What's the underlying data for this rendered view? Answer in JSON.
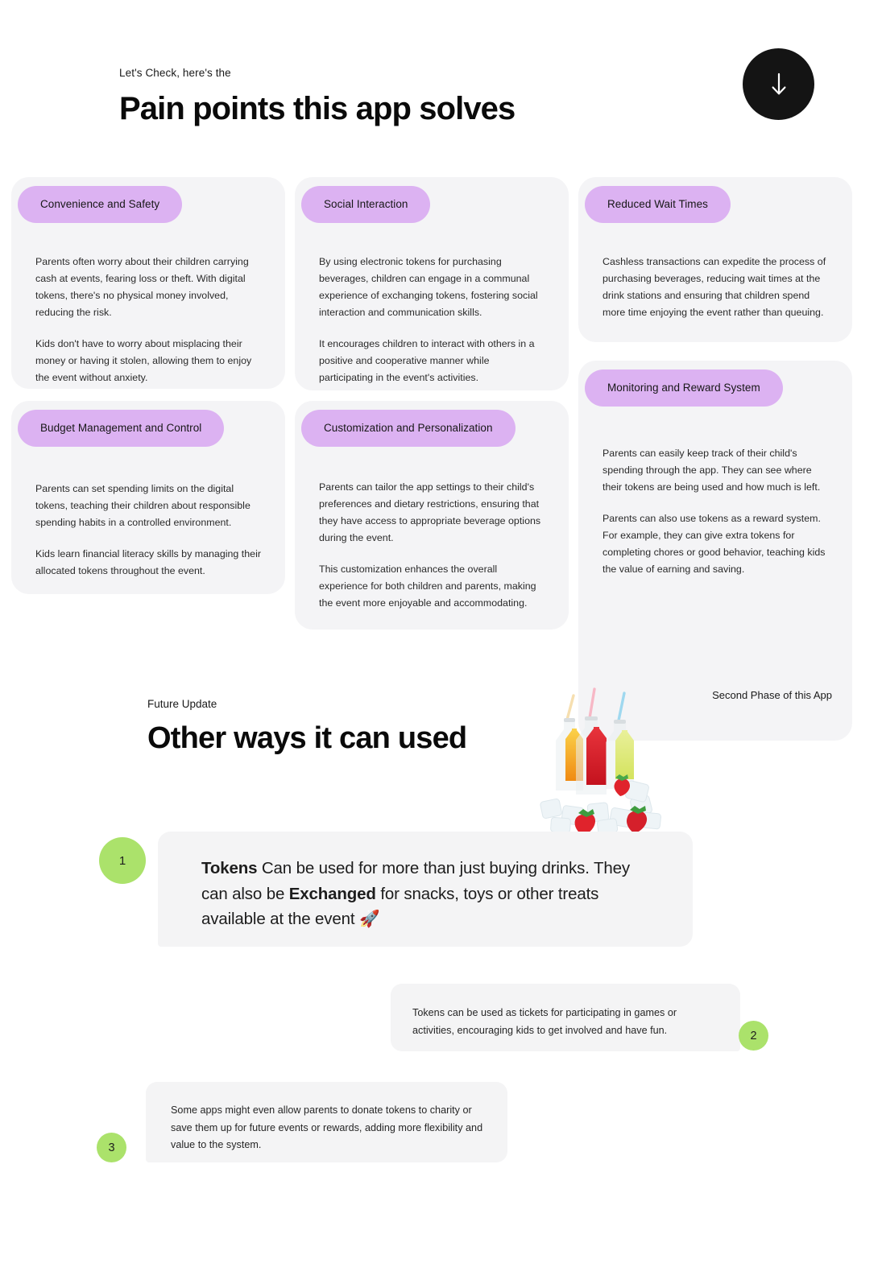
{
  "section1": {
    "eyebrow": "Let's Check, here's the",
    "title": "Pain points this app solves",
    "scroll_button_icon": "arrow-down-icon",
    "accent_pill_color": "#DCB2F2",
    "card_bg_color": "#F4F4F6",
    "cards": [
      {
        "pill": "Convenience and Safety",
        "paragraphs": [
          "Parents often worry about their children carrying cash at events, fearing loss or theft. With digital tokens, there's no physical money involved, reducing the risk.",
          "Kids don't have to worry about misplacing their money or having it stolen, allowing them to enjoy the event without anxiety."
        ]
      },
      {
        "pill": "Social Interaction",
        "paragraphs": [
          "By using electronic tokens for purchasing beverages, children can engage in a communal experience of exchanging tokens, fostering social interaction and communication skills.",
          "It encourages children to interact with others in a positive and cooperative manner while participating in the event's activities."
        ]
      },
      {
        "pill": "Reduced Wait Times",
        "paragraphs": [
          "Cashless transactions can expedite the process of purchasing beverages, reducing wait times at the drink stations and ensuring that children spend more time enjoying the event rather than queuing."
        ]
      },
      {
        "pill": "Monitoring and Reward System",
        "paragraphs": [
          "Parents can easily keep track of their child's spending through the app. They can see where their tokens are being used and how much is left.",
          "Parents can also use tokens as a reward system. For example, they can give extra tokens for completing chores or good behavior, teaching kids the value of earning and saving."
        ]
      },
      {
        "pill": "Budget Management and Control",
        "paragraphs": [
          "Parents can set spending limits on the digital tokens, teaching their children about responsible spending habits in a controlled environment.",
          "Kids learn financial literacy skills by managing their allocated tokens throughout the event."
        ]
      },
      {
        "pill": "Customization and Personalization",
        "paragraphs": [
          "Parents can tailor the app settings to their child's preferences and dietary restrictions, ensuring that they have access to appropriate beverage options during the event.",
          "This customization enhances the overall experience for both children and parents, making the event more enjoyable and accommodating."
        ]
      }
    ]
  },
  "section2": {
    "eyebrow": "Future Update",
    "title": "Other ways it can used",
    "phase_label": "Second Phase of this App",
    "illustration": "drink-bottles-on-ice-image",
    "badge_color": "#ABE26B",
    "bubble_bg_color": "#F4F4F5",
    "bubbles": [
      {
        "number": "1",
        "lead": "Tokens",
        "text_after_lead": " Can be used for more than just buying drinks. They can also be ",
        "emphasis": "Exchanged",
        "text_tail": " for snacks, toys or other treats available at the event 🚀",
        "full_text": "Tokens Can be used for more than just buying drinks. They can also be Exchanged for snacks, toys or other treats available at the event 🚀"
      },
      {
        "number": "2",
        "full_text": "Tokens can be used as tickets for participating in games or activities, encouraging kids to get involved and have fun."
      },
      {
        "number": "3",
        "full_text": "Some apps might even allow parents to donate tokens to charity or save them up for future events or rewards, adding more flexibility and value to the system."
      }
    ]
  }
}
